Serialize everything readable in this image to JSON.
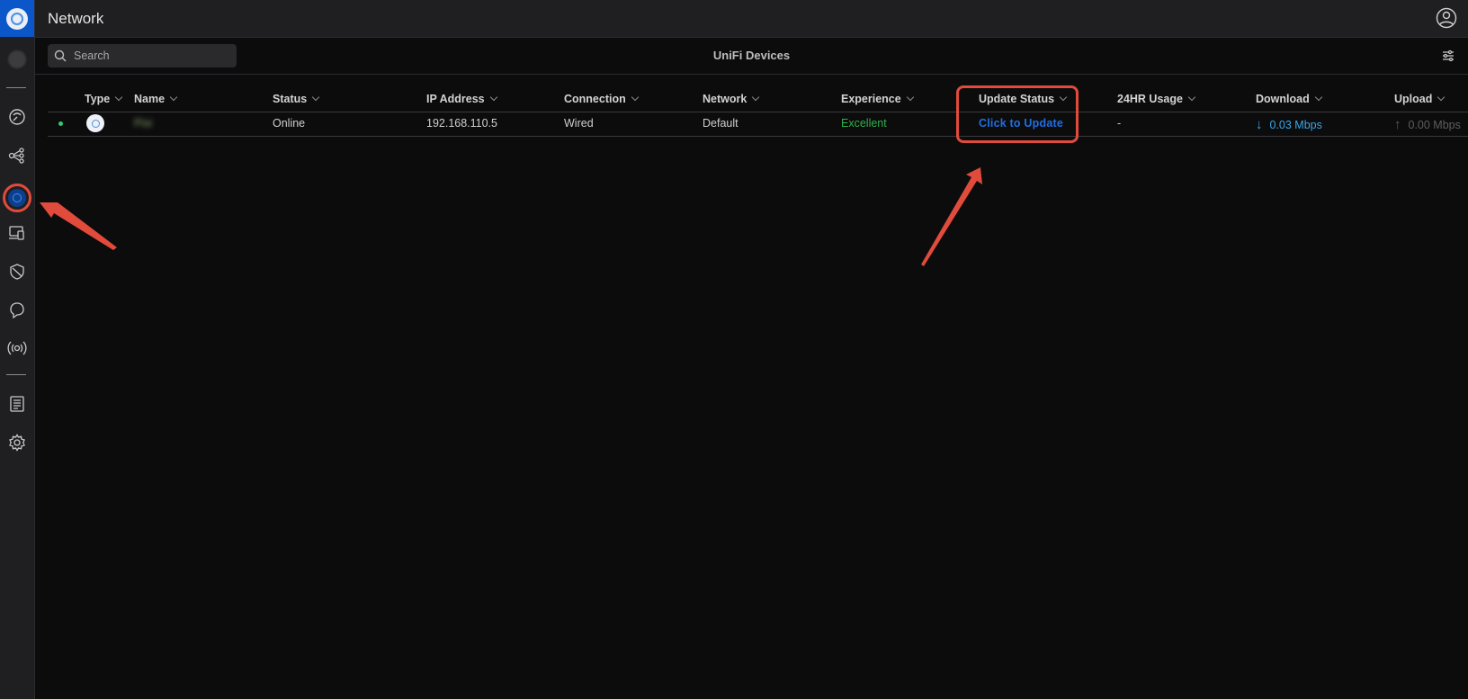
{
  "header": {
    "title": "Network"
  },
  "toolbar": {
    "search_placeholder": "Search",
    "page_title": "UniFi Devices"
  },
  "table": {
    "columns": [
      "Type",
      "Name",
      "Status",
      "IP Address",
      "Connection",
      "Network",
      "Experience",
      "Update Status",
      "24HR Usage",
      "Download",
      "Upload"
    ],
    "rows": [
      {
        "status_dot_color": "#2ecc71",
        "type_icon": "access-point-icon",
        "name": "Pixi",
        "status": "Online",
        "ip_address": "192.168.110.5",
        "connection": "Wired",
        "network": "Default",
        "experience": "Excellent",
        "update_status": "Click to Update",
        "usage_24hr": "-",
        "download": "0.03 Mbps",
        "upload": "0.00 Mbps"
      }
    ]
  },
  "sidebar": {
    "icons": [
      "unifi-logo-icon",
      "site-avatar-icon",
      "dashboard-icon",
      "topology-icon",
      "unifi-devices-icon",
      "client-devices-icon",
      "security-icon",
      "insights-icon",
      "radios-icon",
      "logs-icon",
      "settings-icon"
    ]
  },
  "colors": {
    "accent": "#1e6fe6",
    "brand": "#0b57c9",
    "success": "#2fb14b",
    "annotation": "#e04b3c",
    "download": "#3aa6e8"
  }
}
